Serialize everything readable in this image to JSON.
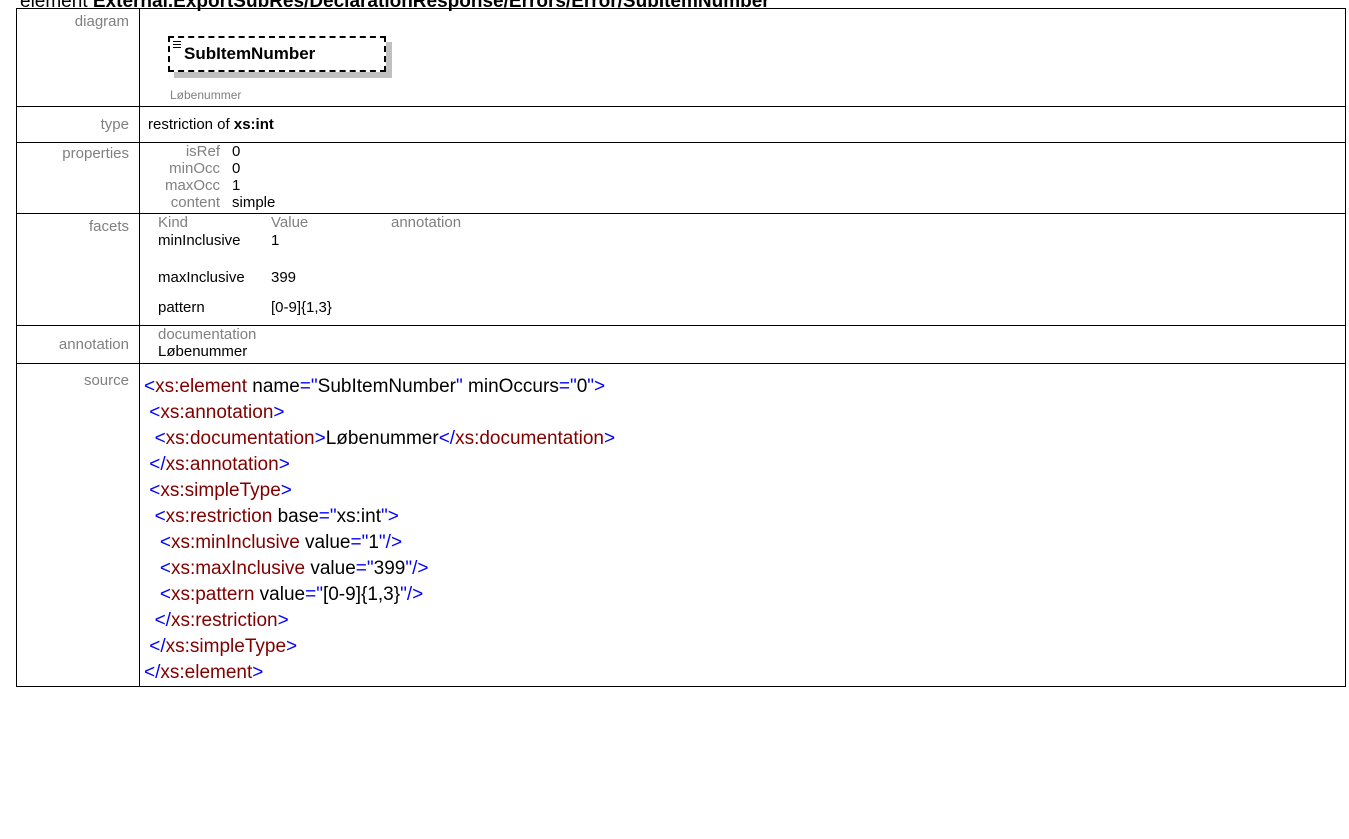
{
  "heading": {
    "prefix": "element ",
    "path": "External.ExportSubRes/DeclarationResponse/Errors/Error/SubItemNumber"
  },
  "diagram": {
    "label": "diagram",
    "node_name": "SubItemNumber",
    "node_doc": "Løbenummer"
  },
  "type": {
    "label": "type",
    "prefix": "restriction of ",
    "base": "xs:int"
  },
  "properties": {
    "label": "properties",
    "rows": [
      {
        "key": "isRef",
        "value": "0"
      },
      {
        "key": "minOcc",
        "value": "0"
      },
      {
        "key": "maxOcc",
        "value": "1"
      },
      {
        "key": "content",
        "value": "simple"
      }
    ]
  },
  "facets": {
    "label": "facets",
    "headers": [
      "Kind",
      "Value",
      "annotation"
    ],
    "rows": [
      {
        "kind": "minInclusive",
        "value": "1",
        "annotation": ""
      },
      {
        "kind": "maxInclusive",
        "value": "399",
        "annotation": ""
      },
      {
        "kind": "pattern",
        "value": "[0-9]{1,3}",
        "annotation": ""
      }
    ]
  },
  "annotation": {
    "label": "annotation",
    "header": "documentation",
    "text": "Løbenummer"
  },
  "source": {
    "label": "source",
    "lines": [
      "<xs:element name=\"SubItemNumber\" minOccurs=\"0\">",
      " <xs:annotation>",
      "  <xs:documentation>Løbenummer</xs:documentation>",
      " </xs:annotation>",
      " <xs:simpleType>",
      "  <xs:restriction base=\"xs:int\">",
      "   <xs:minInclusive value=\"1\"/>",
      "   <xs:maxInclusive value=\"399\"/>",
      "   <xs:pattern value=\"[0-9]{1,3}\"/>",
      "  </xs:restriction>",
      " </xs:simpleType>",
      "</xs:element>"
    ]
  }
}
